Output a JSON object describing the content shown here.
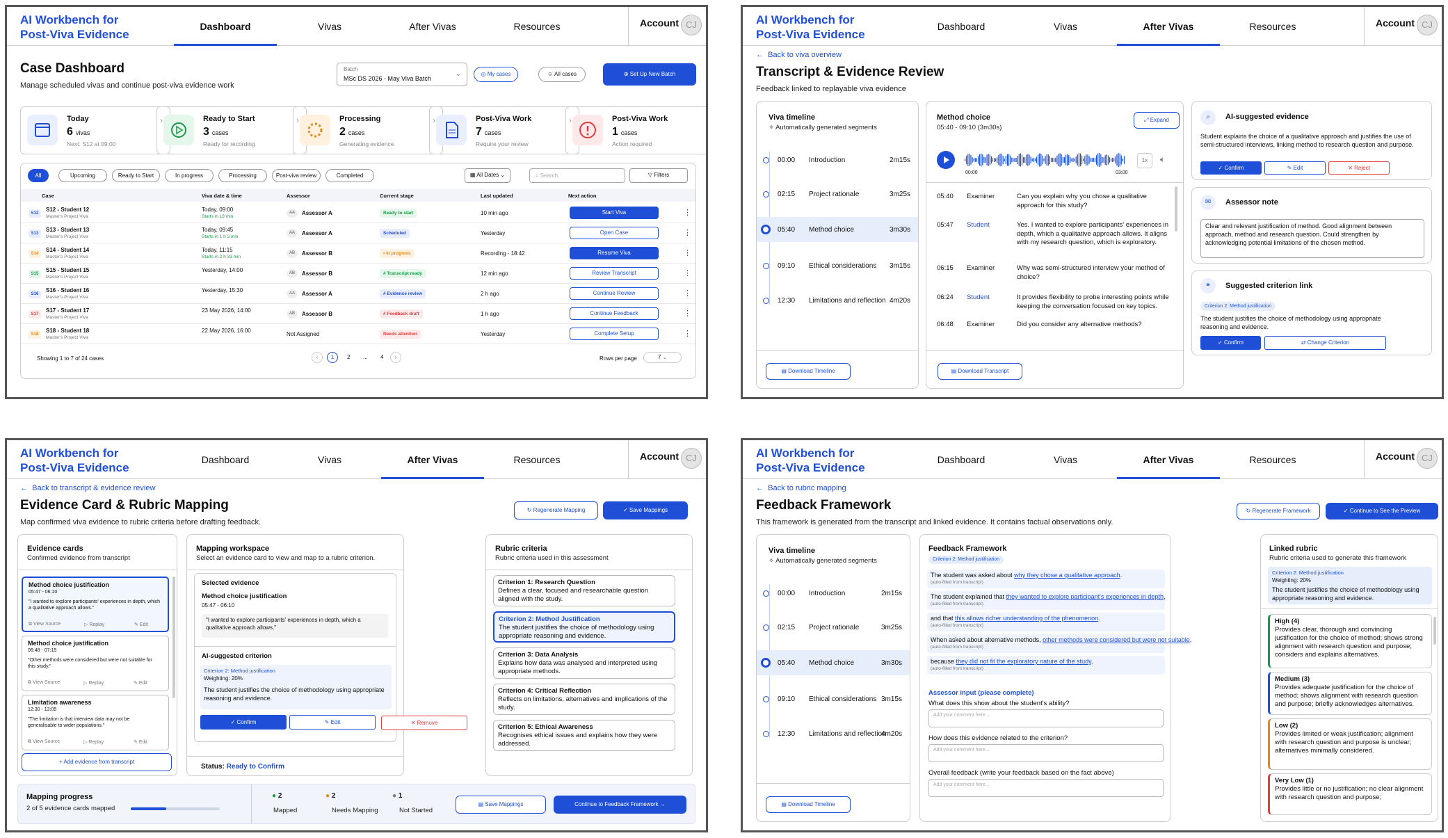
{
  "app": {
    "logo_line1": "AI Workbench for",
    "logo_line2": "Post-Viva Evidence",
    "nav": [
      "Dashboard",
      "Vivas",
      "After Vivas",
      "Resources"
    ],
    "account": "Account",
    "avatar": "CJ"
  },
  "dashboard": {
    "title": "Case Dashboard",
    "subtitle": "Manage scheduled vivas and continue post-viva evidence work",
    "batch_label": "Batch",
    "batch_value": "MSc DS 2026 - May Viva Batch",
    "my_cases": "My cases",
    "all_cases": "All cases",
    "setup_batch": "Set Up New Batch",
    "stats": [
      {
        "title": "Today",
        "count": "6",
        "unit": "vivas",
        "desc": "Next: S12 at 09:00"
      },
      {
        "title": "Ready to Start",
        "count": "3",
        "unit": "cases",
        "desc": "Ready for recording"
      },
      {
        "title": "Processing",
        "count": "2",
        "unit": "cases",
        "desc": "Generating evidence"
      },
      {
        "title": "Post-Viva Work",
        "count": "7",
        "unit": "cases",
        "desc": "Require your review"
      },
      {
        "title": "Post-Viva Work",
        "count": "1",
        "unit": "cases",
        "desc": "Action required"
      }
    ],
    "filters": [
      "All",
      "Upcoming",
      "Ready to Start",
      "In progress",
      "Processing",
      "Post-viva review",
      "Completed"
    ],
    "all_dates": "All Dates",
    "search_placeholder": "Search",
    "filters_btn": "Filters",
    "columns": [
      "Case",
      "Viva date & time",
      "Assessor",
      "Current stage",
      "Last updated",
      "Next action"
    ],
    "rows": [
      {
        "id": "S12",
        "name": "S12 - Student 12",
        "project": "Master's Project Viva",
        "date": "Today, 09:00",
        "note": "Starts in 18 min",
        "ai": "AA",
        "assessor": "Assessor A",
        "stage": "Ready to start",
        "updated": "10 min ago",
        "action": "Start Viva"
      },
      {
        "id": "S13",
        "name": "S13 - Student 13",
        "project": "Master's Project Viva",
        "date": "Today, 09:45",
        "note": "Starts in 1 h 3 min",
        "ai": "AA",
        "assessor": "Assessor A",
        "stage": "Scheduled",
        "updated": "Yesterday",
        "action": "Open Case"
      },
      {
        "id": "S14",
        "name": "S14 - Student 14",
        "project": "Master's Project Viva",
        "date": "Today, 11:15",
        "note": "Starts in 2 h 33 min",
        "ai": "AB",
        "assessor": "Assessor B",
        "stage": "• In progress",
        "updated": "Recording - 18:42",
        "action": "Resume Viva"
      },
      {
        "id": "S15",
        "name": "S15 - Student 15",
        "project": "Master's Project Viva",
        "date": "Yesterday, 14:00",
        "note": "",
        "ai": "AB",
        "assessor": "Assessor B",
        "stage": "# Transcript ready",
        "updated": "12 min ago",
        "action": "Review Transcript"
      },
      {
        "id": "S16",
        "name": "S16 - Student 16",
        "project": "Master's Project Viva",
        "date": "Yesterday, 15:30",
        "note": "",
        "ai": "AA",
        "assessor": "Assessor A",
        "stage": "# Evidence review",
        "updated": "2 h ago",
        "action": "Continue Review"
      },
      {
        "id": "S17",
        "name": "S17 - Student 17",
        "project": "Master's Project Viva",
        "date": "23 May 2026, 14:00",
        "note": "",
        "ai": "AB",
        "assessor": "Assessor B",
        "stage": "# Feedback draft",
        "updated": "1 h ago",
        "action": "Continue Feedback"
      },
      {
        "id": "S18",
        "name": "S18 - Student 18",
        "project": "Master's Project Viva",
        "date": "22 May 2026, 16:00",
        "note": "",
        "ai": "",
        "assessor": "Not Assigned",
        "stage": "Needs attention",
        "updated": "Yesterday",
        "action": "Complete Setup"
      }
    ],
    "showing": "Showing 1 to 7 of 24 cases",
    "pages": [
      "1",
      "2",
      "...",
      "4"
    ],
    "rows_per_page": "Rows per page",
    "rows_per_page_value": "7"
  },
  "transcript": {
    "back": "Back to viva overview",
    "title": "Transcript & Evidence Review",
    "subtitle": "Feedback linked to replayable viva evidence",
    "timeline_title": "Viva timeline",
    "timeline_sub": "Automatically generated segments",
    "segments": [
      {
        "time": "00:00",
        "label": "Introduction",
        "dur": "2m15s"
      },
      {
        "time": "02:15",
        "label": "Project rationale",
        "dur": "3m25s"
      },
      {
        "time": "05:40",
        "label": "Method choice",
        "dur": "3m30s"
      },
      {
        "time": "09:10",
        "label": "Ethical considerations",
        "dur": "3m15s"
      },
      {
        "time": "12:30",
        "label": "Limitations and reflection",
        "dur": "4m20s"
      }
    ],
    "download_timeline": "Download Timeline",
    "segment_title": "Method choice",
    "segment_range": "05:40 - 09:10 (3m30s)",
    "expand": "Expand",
    "audio_start": "00:00",
    "audio_end": "03:00",
    "speed": "1x",
    "lines": [
      {
        "time": "05:40",
        "speaker": "Examiner",
        "text": "Can you explain why you chose a qualitative approach for this study?"
      },
      {
        "time": "05:47",
        "speaker": "Student",
        "text": "Yes. I wanted to explore participants' experiences in depth, which a qualitative approach allows. It aligns with my research question, which is exploratory."
      },
      {
        "time": "06:15",
        "speaker": "Examiner",
        "text": "Why was semi-structured interview your method of choice?"
      },
      {
        "time": "06:24",
        "speaker": "Student",
        "text": "It provides flexibility to probe interesting points while keeping the conversation focused on key topics."
      },
      {
        "time": "06:48",
        "speaker": "Examiner",
        "text": "Did you consider any alternative methods?"
      }
    ],
    "download_transcript": "Download Transcript",
    "ai_title": "AI-suggested evidence",
    "ai_text": "Student explains the choice of a qualitative approach and justifies the use of semi-structured interviews, linking method to research question and purpose.",
    "confirm": "Confirm",
    "edit": "Edit",
    "reject": "Reject",
    "note_title": "Assessor note",
    "note_text": "Clear and relevant justification of method. Good alignment between approach, method and research question. Could strengthen by acknowledging potential limitations of the chosen method.",
    "link_title": "Suggested criterion link",
    "link_tag": "Criterion 2: Method justification",
    "link_text": "The student justifies the choice of methodology using appropriate reasoning and evidence.",
    "change_criterion": "Change Criterion"
  },
  "mapping": {
    "back": "Back to transcript & evidence review",
    "title": "Evidence Card & Rubric Mapping",
    "subtitle": "Map confirmed viva evidence to rubric criteria before drafting feedback.",
    "regenerate": "Regenerate Mapping",
    "save": "Save Mappings",
    "cards_title": "Evidence cards",
    "cards_sub": "Confirmed evidence from transcript",
    "cards": [
      {
        "title": "Method choice justification",
        "time": "05:47 - 06:10",
        "quote": "\"I wanted to explore participants' experiences in depth, which a qualitative approach allows.\""
      },
      {
        "title": "Method choice justification",
        "time": "06:48 - 07:15",
        "quote": "\"Other methods were considered but were not suitable for this study.\""
      },
      {
        "title": "Limitation awareness",
        "time": "12:30 - 13:05",
        "quote": "\"The limitation is that interview data may not be generalisable to wider populations.\""
      }
    ],
    "view_source": "View Source",
    "replay": "Replay",
    "edit": "Edit",
    "add_evidence": "+ Add evidence from transcript",
    "workspace_title": "Mapping workspace",
    "workspace_sub": "Select an evidence card to view and map to a rubric criterion.",
    "selected_label": "Selected evidence",
    "selected_title": "Method choice justification",
    "selected_time": "05:47 - 06:10",
    "selected_quote": "\"I wanted to explore participants' experiences in depth, which a qualitative approach allows.\"",
    "ai_label": "AI-suggested criterion",
    "ai_tag": "Criterion 2: Method justification",
    "ai_weight": "Weighting: 20%",
    "ai_text": "The student justifies the choice of methodology using appropriate reasoning and evidence.",
    "confirm": "Confirm",
    "remove": "Remove",
    "status_label": "Status:",
    "status_value": "Ready to Confirm",
    "rubric_title": "Rubric criteria",
    "rubric_sub": "Rubric criteria used in this assessment",
    "criteria": [
      {
        "title": "Criterion 1: Research Question",
        "text": "Defines a clear, focused and researchable question aligned with the study."
      },
      {
        "title": "Criterion 2: Method Justification",
        "text": "The student justifies the choice of methodology using appropriate reasoning and evidence."
      },
      {
        "title": "Criterion 3: Data Analysis",
        "text": "Explains how data was analysed and interpreted using appropriate methods."
      },
      {
        "title": "Criterion 4: Critical Reflection",
        "text": "Reflects on limitations, alternatives and implications of the study."
      },
      {
        "title": "Criterion 5: Ethical Awareness",
        "text": "Recognises ethical issues and explains how they were addressed."
      }
    ],
    "progress_title": "Mapping progress",
    "progress_text": "2 of 5 evidence cards mapped",
    "progress_fraction": 0.4,
    "mapped_n": "2",
    "mapped": "Mapped",
    "needs_n": "2",
    "needs": "Needs Mapping",
    "not_started_n": "1",
    "not_started": "Not Started",
    "continue": "Continue to Feedback Framework"
  },
  "framework": {
    "back": "Back to rubric mapping",
    "title": "Feedback Framework",
    "subtitle": "This framework is generated from the transcript and linked evidence. It contains factual observations only.",
    "regenerate": "Regenerate Framework",
    "continue": "Continue to See the Preview",
    "fw_title": "Feedback Framework",
    "fw_tag": "Criterion 2: Method justification",
    "sentences": [
      {
        "pre": "The student was asked about",
        "link": "why they chose a qualitative approach",
        "end": "."
      },
      {
        "pre": "The student explained that",
        "link": "they wanted to explore participant's experiences in depth",
        "end": ","
      },
      {
        "pre": "and that",
        "link": "this allows richer understanding of the phenomenon",
        "end": "."
      },
      {
        "pre": "When asked about alternative methods,",
        "link": "other methods were considered but were not suitable",
        "end": ","
      },
      {
        "pre": "because",
        "link": "they did not fit the exploratory nature of the study",
        "end": "."
      }
    ],
    "autofill": "(auto-filled from transcript)",
    "assessor_input": "Assessor input (please complete)",
    "questions": [
      "What does this show about the student's ability?",
      "How does this evidence related to the criterion?",
      "Overall feedback (write your feedback based on the fact above)"
    ],
    "comment_placeholder": "Add your comment here...",
    "rubric_title": "Linked rubric",
    "rubric_sub": "Rubric criteria used to generate this framework",
    "rubric_tag": "Criterion 2: Method justification",
    "rubric_weight": "Weighting: 20%",
    "rubric_text": "The student justifies the choice of methodology using appropriate reasoning and evidence.",
    "levels": [
      {
        "title": "High (4)",
        "text": "Provides clear, thorough and convincing justification for the choice of method; shows strong alignment with research question and purpose; considers and explains alternatives.",
        "color": "#1a9a48"
      },
      {
        "title": "Medium (3)",
        "text": "Provides adequate justification for the choice of method; shows alignment with research question and purpose; briefly acknowledges alternatives.",
        "color": "#1f4fd6"
      },
      {
        "title": "Low (2)",
        "text": "Provides limited or weak justification; alignment with research question and purpose is unclear; alternatives minimally considered.",
        "color": "#e08a1e"
      },
      {
        "title": "Very Low (1)",
        "text": "Provides little or no justification; no clear alignment with research question and purpose;",
        "color": "#e23c3c"
      }
    ]
  }
}
